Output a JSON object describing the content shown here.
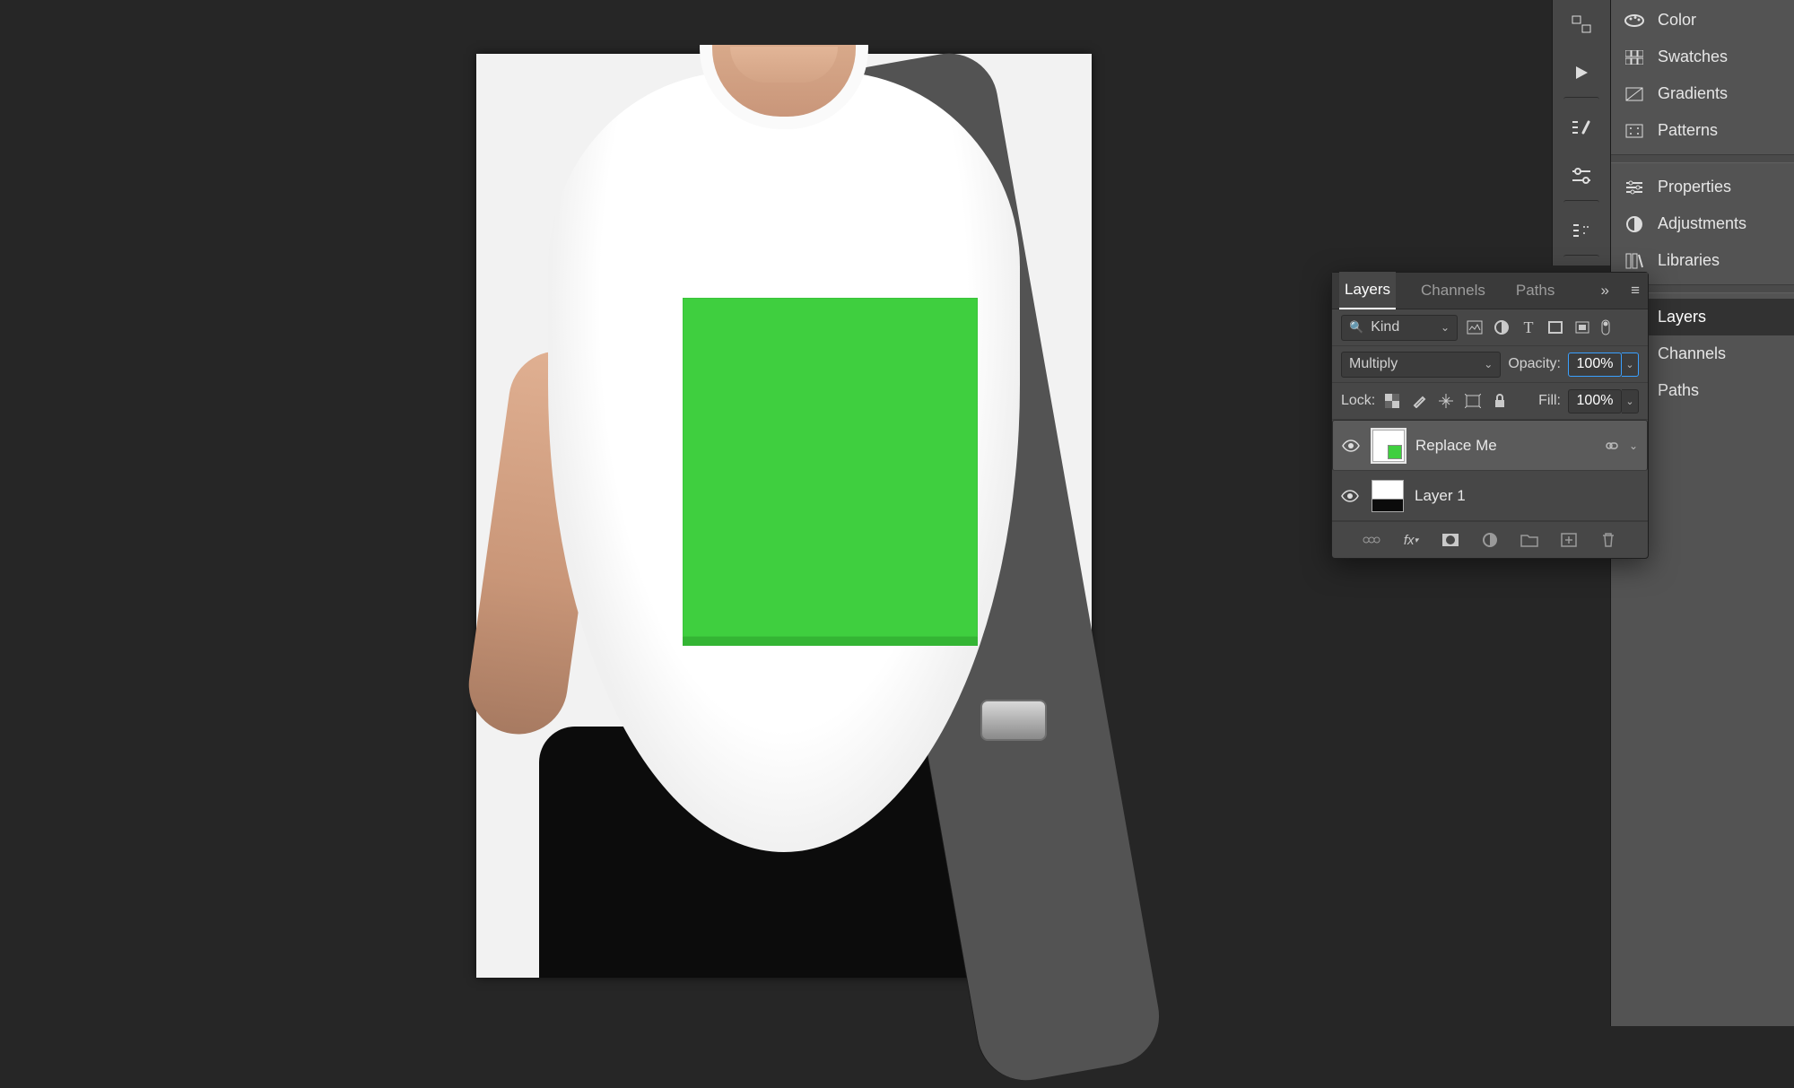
{
  "right_panels": {
    "group1": [
      "Color",
      "Swatches",
      "Gradients",
      "Patterns"
    ],
    "group2": [
      "Properties",
      "Adjustments",
      "Libraries"
    ],
    "group3": [
      "Layers",
      "Channels",
      "Paths"
    ],
    "active": "Layers"
  },
  "layers_panel": {
    "tabs": [
      "Layers",
      "Channels",
      "Paths"
    ],
    "active_tab": "Layers",
    "kind_filter": "Kind",
    "blend_mode": "Multiply",
    "opacity_label": "Opacity:",
    "opacity_value": "100%",
    "lock_label": "Lock:",
    "fill_label": "Fill:",
    "fill_value": "100%",
    "layers": [
      {
        "name": "Replace Me",
        "visible": true,
        "selected": true,
        "smart": true
      },
      {
        "name": "Layer 1",
        "visible": true,
        "selected": false,
        "smart": false
      }
    ]
  }
}
